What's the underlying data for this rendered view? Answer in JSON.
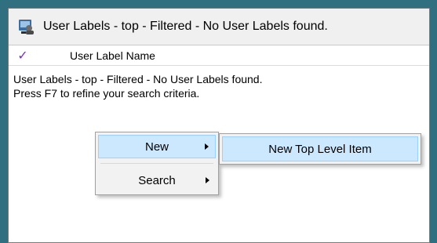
{
  "window": {
    "title": "User Labels - top - Filtered - No User Labels found.",
    "icon": "user-labels-app-icon"
  },
  "list": {
    "check_glyph": "✓",
    "column_header": "User Label Name",
    "message_line1": "User Labels - top - Filtered - No User Labels found.",
    "message_line2": "Press F7 to refine your search criteria."
  },
  "context_menu": {
    "items": [
      {
        "label": "New",
        "has_submenu": true,
        "selected": true
      },
      {
        "label": "Search",
        "has_submenu": true,
        "selected": false
      }
    ]
  },
  "submenu": {
    "items": [
      {
        "label": "New Top Level Item",
        "selected": true
      }
    ]
  },
  "colors": {
    "selection_bg": "#cce8ff",
    "selection_border": "#99d1ff",
    "check_color": "#7b2fbe"
  }
}
